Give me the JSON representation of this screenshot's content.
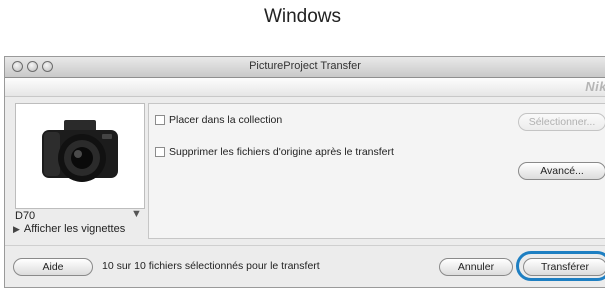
{
  "heading": "Windows",
  "window": {
    "title": "PictureProject Transfer",
    "brand": "Nik"
  },
  "device": {
    "name": "D70",
    "show_thumbnails_label": "Afficher les vignettes"
  },
  "options": {
    "add_to_collection_label": "Placer dans la collection",
    "delete_originals_label": "Supprimer les fichiers d'origine après le transfert",
    "select_button": "Sélectionner...",
    "advanced_button": "Avancé..."
  },
  "footer": {
    "help_button": "Aide",
    "status_text": "10 sur 10 fichiers sélectionnés pour le transfert",
    "cancel_button": "Annuler",
    "transfer_button": "Transférer"
  },
  "colors": {
    "highlight": "#1e7fc2"
  },
  "icons": [
    "close-icon",
    "minimize-icon",
    "zoom-icon",
    "camera-icon",
    "disclosure-triangle-icon",
    "dropdown-arrow-icon"
  ]
}
